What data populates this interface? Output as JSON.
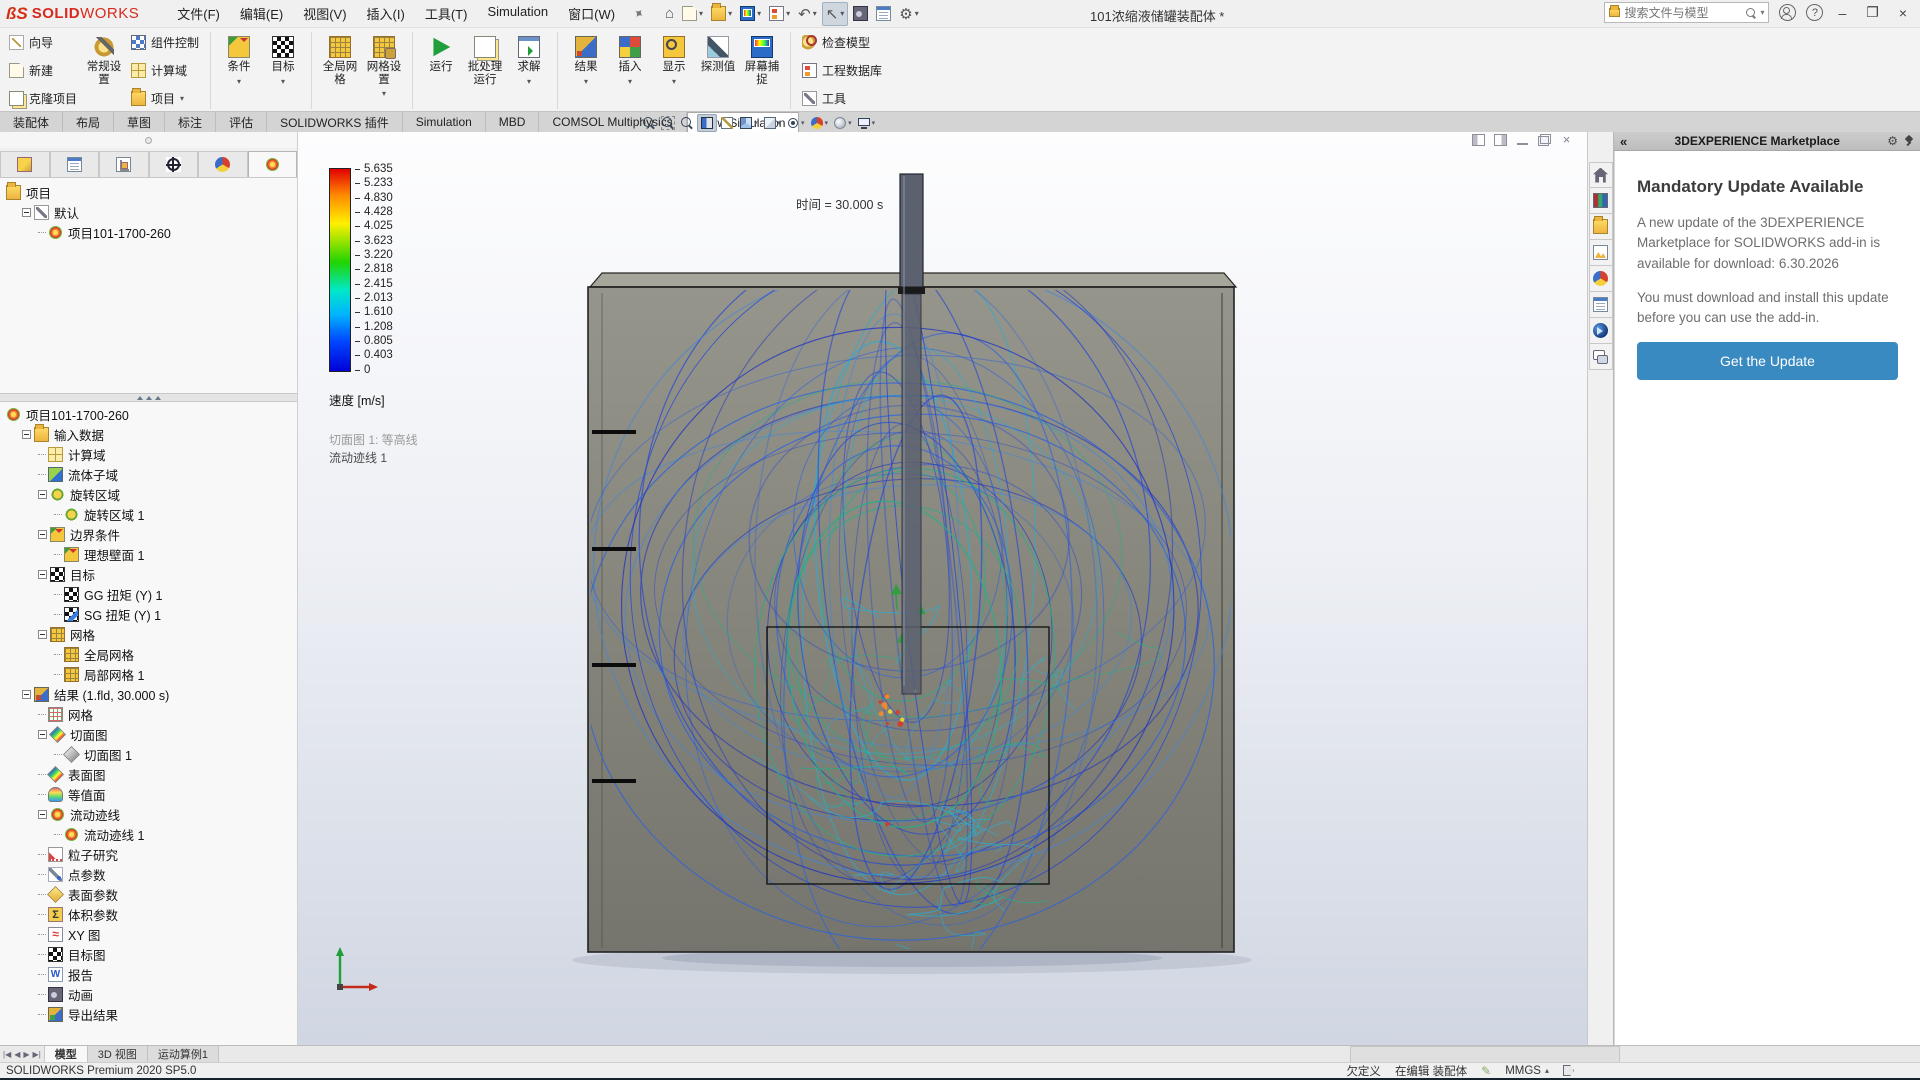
{
  "titlebar": {
    "logo_mark": "ßS",
    "logo_word_bold": "SOLID",
    "logo_word_light": "WORKS",
    "menus": [
      "文件(F)",
      "编辑(E)",
      "视图(V)",
      "插入(I)",
      "工具(T)",
      "Simulation",
      "窗口(W)"
    ],
    "quick_tools": [
      {
        "name": "home-icon",
        "glyph": "⌂",
        "caret": false
      },
      {
        "name": "new-document-icon",
        "glyph": "",
        "ic": "new-project",
        "caret": true
      },
      {
        "name": "open-icon",
        "glyph": "",
        "ic": "project",
        "caret": true
      },
      {
        "name": "save-icon",
        "glyph": "",
        "ic": "screen-capture",
        "caret": true
      },
      {
        "name": "print-icon",
        "glyph": "",
        "ic": "engineering-database",
        "caret": true
      },
      {
        "name": "undo-icon",
        "glyph": "↶",
        "caret": true
      },
      {
        "name": "select-cursor-icon",
        "glyph": "↖",
        "caret": true,
        "pressed": true
      },
      {
        "name": "rebuild-traffic-light-icon",
        "glyph": "",
        "ic": "animation",
        "caret": false
      },
      {
        "name": "options-list-icon",
        "glyph": "",
        "ic": "properties",
        "caret": false
      },
      {
        "name": "settings-gear-icon",
        "glyph": "⚙",
        "caret": true
      }
    ],
    "doc_title": "101浓缩液储罐装配体 *",
    "search_placeholder": "搜索文件与模型"
  },
  "ribbon": {
    "stack_left": [
      {
        "label": "向导",
        "icon": "wizard"
      },
      {
        "label": "新建",
        "icon": "new-project"
      },
      {
        "label": "克隆项目",
        "icon": "clone-project"
      }
    ],
    "big_general": {
      "label": "常规设置",
      "icon": "general-settings"
    },
    "stack_mid": [
      {
        "label": "组件控制",
        "icon": "component-control"
      },
      {
        "label": "计算域",
        "icon": "computational-domain"
      },
      {
        "label": "项目",
        "icon": "project",
        "caret": true
      }
    ],
    "groups": [
      [
        {
          "label": "条件",
          "icon": "conditions",
          "caret": true
        },
        {
          "label": "目标",
          "icon": "goals",
          "caret": true
        }
      ],
      [
        {
          "label": "全局网格",
          "icon": "global-mesh",
          "caret": false
        },
        {
          "label": "网格设置",
          "icon": "mesh-settings",
          "caret": true
        }
      ],
      [
        {
          "label": "运行",
          "icon": "run",
          "caret": false
        },
        {
          "label": "批处理运行",
          "icon": "batch-run",
          "caret": false
        },
        {
          "label": "求解",
          "icon": "solve",
          "caret": true
        }
      ],
      [
        {
          "label": "结果",
          "icon": "results",
          "caret": true
        },
        {
          "label": "插入",
          "icon": "insert",
          "caret": true
        },
        {
          "label": "显示",
          "icon": "display",
          "caret": true
        },
        {
          "label": "探测值",
          "icon": "probe",
          "caret": false
        },
        {
          "label": "屏幕捕捉",
          "icon": "screen-capture",
          "caret": false
        }
      ]
    ],
    "stack_right": [
      {
        "label": "检查模型",
        "icon": "check-geometry"
      },
      {
        "label": "工程数据库",
        "icon": "engineering-database"
      },
      {
        "label": "工具",
        "icon": "tools"
      }
    ]
  },
  "command_tabs": {
    "tabs": [
      "装配体",
      "布局",
      "草图",
      "标注",
      "评估",
      "SOLIDWORKS 插件",
      "Simulation",
      "MBD",
      "COMSOL Multiphysics",
      "Flow Simulation"
    ],
    "active_index": 9
  },
  "headsup_tools": [
    {
      "name": "zoom-fit-icon",
      "cls": "hu-zoom-fit",
      "caret": false
    },
    {
      "name": "zoom-area-icon",
      "cls": "hu-zoom-area",
      "caret": false
    },
    {
      "name": "previous-view-icon",
      "cls": "hu-previous-view",
      "caret": false
    },
    {
      "name": "section-view-icon",
      "cls": "hu-section-view",
      "caret": false,
      "pressed": true
    },
    {
      "name": "3d-drawing-view-icon",
      "cls": "hu-3d-drawing",
      "caret": false
    },
    {
      "name": "view-orientation-icon",
      "cls": "hu-view-orientation",
      "caret": true
    },
    {
      "name": "display-style-icon",
      "cls": "hu-display-style",
      "caret": true
    },
    {
      "name": "hide-show-items-icon",
      "cls": "hu-hide-show",
      "caret": true
    },
    {
      "name": "edit-appearance-icon",
      "cls": "hu-appearance",
      "caret": true
    },
    {
      "name": "apply-scene-icon",
      "cls": "hu-scene",
      "caret": true
    },
    {
      "name": "view-settings-icon",
      "cls": "hu-view-settings",
      "caret": true
    }
  ],
  "left_panel": {
    "tabs": [
      {
        "name": "featuremanager-tab",
        "icon": "assembly-tab"
      },
      {
        "name": "propertymanager-tab",
        "icon": "featuremanager-tab"
      },
      {
        "name": "configurationmanager-tab",
        "icon": "configuration-tab"
      },
      {
        "name": "dimxpertmanager-tab",
        "icon": "dimxpert-tab"
      },
      {
        "name": "displaymanager-tab",
        "icon": "displaymanager-tab"
      },
      {
        "name": "flow-simulation-tab",
        "icon": "flowsim-tab",
        "active": true
      }
    ],
    "tree_top": [
      {
        "label": "项目",
        "depth": 0,
        "icon": "flow-folder",
        "exp": false
      },
      {
        "label": "默认",
        "depth": 1,
        "icon": "default-config",
        "exp": true
      },
      {
        "label": "项目101-1700-260",
        "depth": 2,
        "icon": "flow-project",
        "exp": false
      }
    ],
    "tree_main": [
      {
        "label": "项目101-1700-260",
        "depth": 0,
        "icon": "flow-project",
        "exp": false
      },
      {
        "label": "输入数据",
        "depth": 1,
        "icon": "folder-input",
        "exp": true
      },
      {
        "label": "计算域",
        "depth": 2,
        "icon": "comp-domain",
        "exp": false
      },
      {
        "label": "流体子域",
        "depth": 2,
        "icon": "fluid-subdomain",
        "exp": false
      },
      {
        "label": "旋转区域",
        "depth": 2,
        "icon": "rotating-region",
        "exp": true
      },
      {
        "label": "旋转区域 1",
        "depth": 3,
        "icon": "rotating-region",
        "exp": false
      },
      {
        "label": "边界条件",
        "depth": 2,
        "icon": "boundary",
        "exp": true
      },
      {
        "label": "理想壁面 1",
        "depth": 3,
        "icon": "boundary",
        "exp": false
      },
      {
        "label": "目标",
        "depth": 2,
        "icon": "goal",
        "exp": true
      },
      {
        "label": "GG 扭矩 (Y) 1",
        "depth": 3,
        "icon": "goal-global",
        "exp": false
      },
      {
        "label": "SG 扭矩 (Y) 1",
        "depth": 3,
        "icon": "goal-surface",
        "exp": false
      },
      {
        "label": "网格",
        "depth": 2,
        "icon": "mesh",
        "exp": true
      },
      {
        "label": "全局网格",
        "depth": 3,
        "icon": "mesh",
        "exp": false
      },
      {
        "label": "局部网格 1",
        "depth": 3,
        "icon": "mesh-local",
        "exp": false
      },
      {
        "label": "结果 (1.fld, 30.000 s)",
        "depth": 1,
        "icon": "results-data",
        "exp": true
      },
      {
        "label": "网格",
        "depth": 2,
        "icon": "mesh-result",
        "exp": false
      },
      {
        "label": "切面图",
        "depth": 2,
        "icon": "cut-plot",
        "exp": true
      },
      {
        "label": "切面图 1",
        "depth": 3,
        "icon": "cut-plot-gray",
        "exp": false
      },
      {
        "label": "表面图",
        "depth": 2,
        "icon": "surface-plot",
        "exp": false
      },
      {
        "label": "等值面",
        "depth": 2,
        "icon": "isosurface",
        "exp": false
      },
      {
        "label": "流动迹线",
        "depth": 2,
        "icon": "flow-traj",
        "exp": true
      },
      {
        "label": "流动迹线 1",
        "depth": 3,
        "icon": "flow-traj",
        "exp": false
      },
      {
        "label": "粒子研究",
        "depth": 2,
        "icon": "particle-study",
        "exp": false
      },
      {
        "label": "点参数",
        "depth": 2,
        "icon": "point-param",
        "exp": false
      },
      {
        "label": "表面参数",
        "depth": 2,
        "icon": "surface-param",
        "exp": false
      },
      {
        "label": "体积参数",
        "depth": 2,
        "icon": "volume-param",
        "exp": false
      },
      {
        "label": "XY 图",
        "depth": 2,
        "icon": "xy-plot",
        "exp": false
      },
      {
        "label": "目标图",
        "depth": 2,
        "icon": "goal-plot",
        "exp": false
      },
      {
        "label": "报告",
        "depth": 2,
        "icon": "report",
        "exp": false
      },
      {
        "label": "动画",
        "depth": 2,
        "icon": "animation",
        "exp": false
      },
      {
        "label": "导出结果",
        "depth": 2,
        "icon": "export-results",
        "exp": false
      }
    ]
  },
  "viewport": {
    "time_label": "时间 = 30.000 s",
    "legend": {
      "values": [
        "5.635",
        "5.233",
        "4.830",
        "4.428",
        "4.025",
        "3.623",
        "3.220",
        "2.818",
        "2.415",
        "2.013",
        "1.610",
        "1.208",
        "0.805",
        "0.403",
        "0"
      ],
      "param_label": "速度 [m/s]",
      "annotation_1": "切面图 1: 等高线",
      "annotation_2": "流动迹线 1"
    }
  },
  "task_pane": {
    "header_title": "3DEXPERIENCE Marketplace",
    "collapse_glyph": "«",
    "heading": "Mandatory Update Available",
    "para1": "A new update of the 3DEXPERIENCE Marketplace for SOLIDWORKS add-in is available for download: 6.30.2026",
    "para2": "You must download and install this update before you can use the add-in.",
    "button_label": "Get the Update",
    "side_icons": [
      "home",
      "library",
      "folder",
      "view-palette",
      "appearances",
      "properties",
      "threedexp",
      "forum"
    ]
  },
  "model_tabs": {
    "tabs": [
      "模型",
      "3D 视图",
      "运动算例1"
    ],
    "active_index": 0
  },
  "statusbar": {
    "left": "SOLIDWORKS Premium 2020 SP5.0",
    "state": "欠定义",
    "editing": "在编辑 装配体",
    "units": "MMGS"
  },
  "colors": {
    "accent_button": "#3a8ac2",
    "tank_fill_top": "#8e8e84",
    "tank_fill_bottom": "#6e6e64",
    "shaft_fill": "#5c6170",
    "streamline_palette": [
      "#1b2fc4",
      "#2446d4",
      "#2f63da",
      "#3f85dd",
      "#27aed2",
      "#23b087"
    ],
    "hot_specks": [
      "#d83a2a",
      "#f08a2a",
      "#e8d43a"
    ],
    "arrow_green": "#2f9e3f"
  }
}
